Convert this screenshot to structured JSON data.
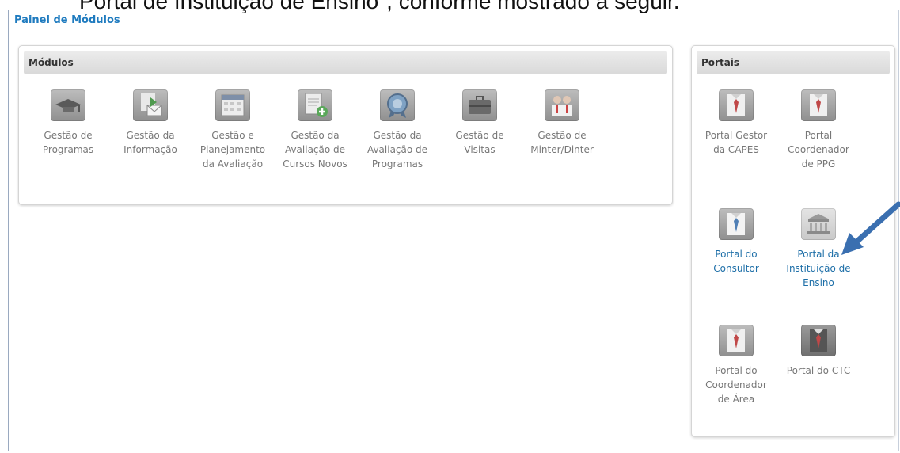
{
  "caption": "Portal de Instituição de Ensino\", conforme mostrado a seguir.",
  "panel_title": "Painel de Módulos",
  "modules": {
    "header": "Módulos",
    "items": [
      {
        "label": "Gestão de\nProgramas",
        "icon": "graduation-cap-icon"
      },
      {
        "label": "Gestão da\nInformação",
        "icon": "document-mail-icon"
      },
      {
        "label": "Gestão e\nPlanejamento\nda Avaliação",
        "icon": "calendar-icon"
      },
      {
        "label": "Gestão da\nAvaliação de\nCursos Novos",
        "icon": "document-add-icon"
      },
      {
        "label": "Gestão da\nAvaliação de\nProgramas",
        "icon": "seal-icon"
      },
      {
        "label": "Gestão de\nVisitas",
        "icon": "briefcase-icon"
      },
      {
        "label": "Gestão de\nMinter/Dinter",
        "icon": "people-icon"
      }
    ]
  },
  "portals": {
    "header": "Portais",
    "items": [
      {
        "label": "Portal Gestor\nda CAPES",
        "icon": "shirt-tie-icon"
      },
      {
        "label": "Portal\nCoordenador\nde PPG",
        "icon": "shirt-tie-icon"
      },
      {
        "label": "Portal do\nConsultor",
        "icon": "shirt-tie-blue-icon"
      },
      {
        "label": "Portal da\nInstituição de\nEnsino",
        "icon": "building-icon"
      },
      {
        "label": "Portal do\nCoordenador\nde Área",
        "icon": "shirt-tie-icon"
      },
      {
        "label": "Portal do CTC",
        "icon": "shirt-tie-dark-icon"
      }
    ]
  },
  "colors": {
    "title": "#1f7bbf",
    "link": "#1e6fa8",
    "arrow": "#3a6fb0"
  }
}
